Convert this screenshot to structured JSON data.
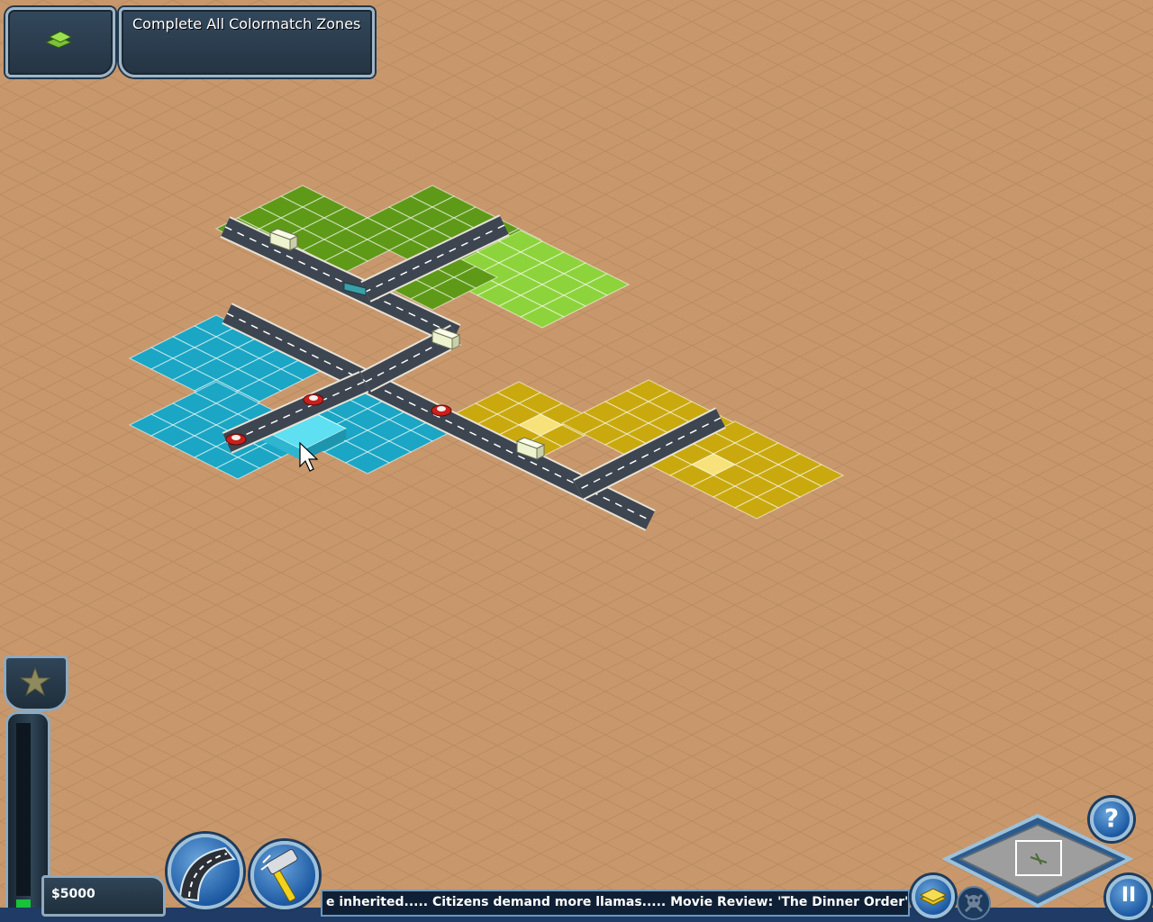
{
  "objective": {
    "text": "Complete All Colormatch Zones"
  },
  "status": {
    "money": "$5000",
    "power_level": 0.06
  },
  "news_ticker": {
    "text": "e inherited.....   Citizens demand more llamas..... Movie Review: 'The Dinner Order' -- Ne"
  },
  "buttons": {
    "help_label": "?",
    "pause_label": "II"
  },
  "icons": {
    "zone_button": "green-zone-tiles-icon",
    "rating": "star-icon",
    "road_tool": "road-icon",
    "bulldoze_tool": "hammer-icon",
    "layers": "zone-layer-icon",
    "disaster": "skull-icon",
    "help": "question-icon",
    "pause": "pause-icon"
  },
  "colors": {
    "ground": "#c8986c",
    "green_zone": "#5e9a18",
    "light_green_zone": "#8dd33b",
    "cyan_zone": "#1aa6c4",
    "yellow_zone": "#c9a90e",
    "road": "#3d4550",
    "hud_panel": "#2a3c4e",
    "power_fill": "#18c23a"
  }
}
